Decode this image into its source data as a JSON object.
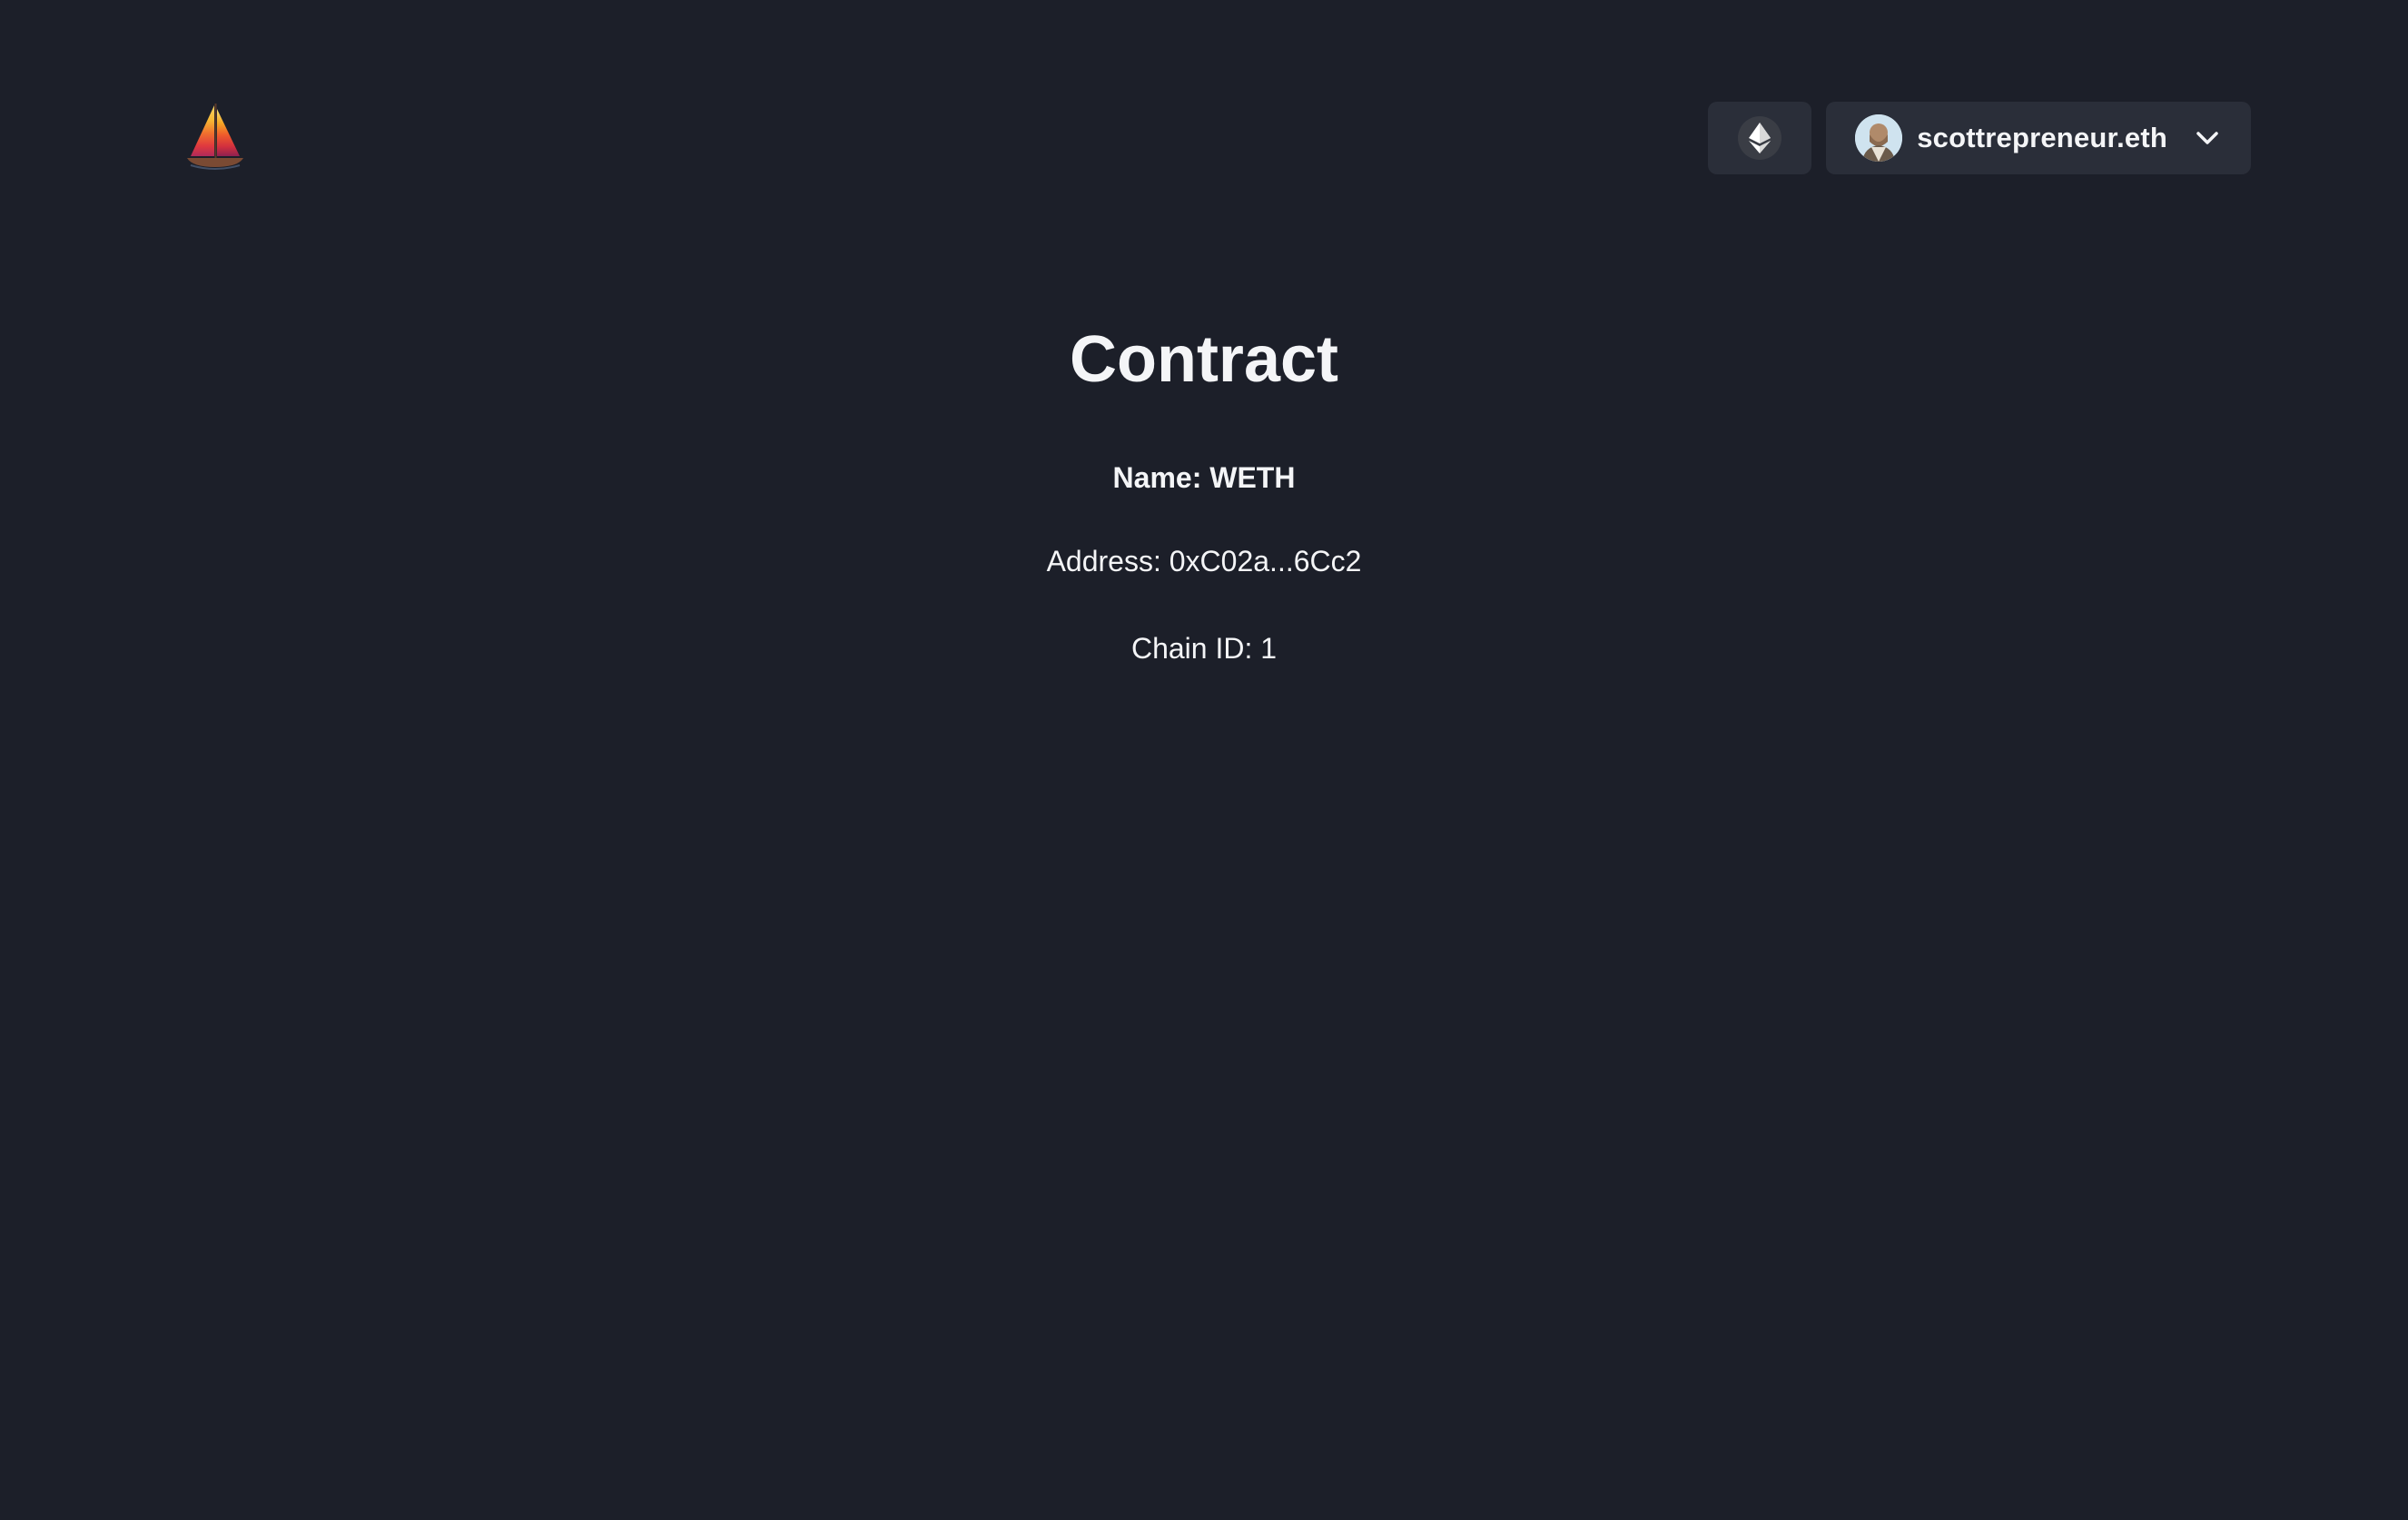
{
  "header": {
    "logo_icon": "sailboat-icon",
    "chain": {
      "icon": "ethereum-icon"
    },
    "account": {
      "name": "scottrepreneur.eth",
      "avatar_icon": "avatar-icon",
      "dropdown_icon": "chevron-down-icon"
    }
  },
  "main": {
    "title": "Contract",
    "name_line": "Name: WETH",
    "address_line": "Address: 0xC02a...6Cc2",
    "chain_line": "Chain ID: 1"
  },
  "colors": {
    "background": "#1c1f29",
    "button_bg": "#2a2e39",
    "text": "#f4f5f7"
  }
}
